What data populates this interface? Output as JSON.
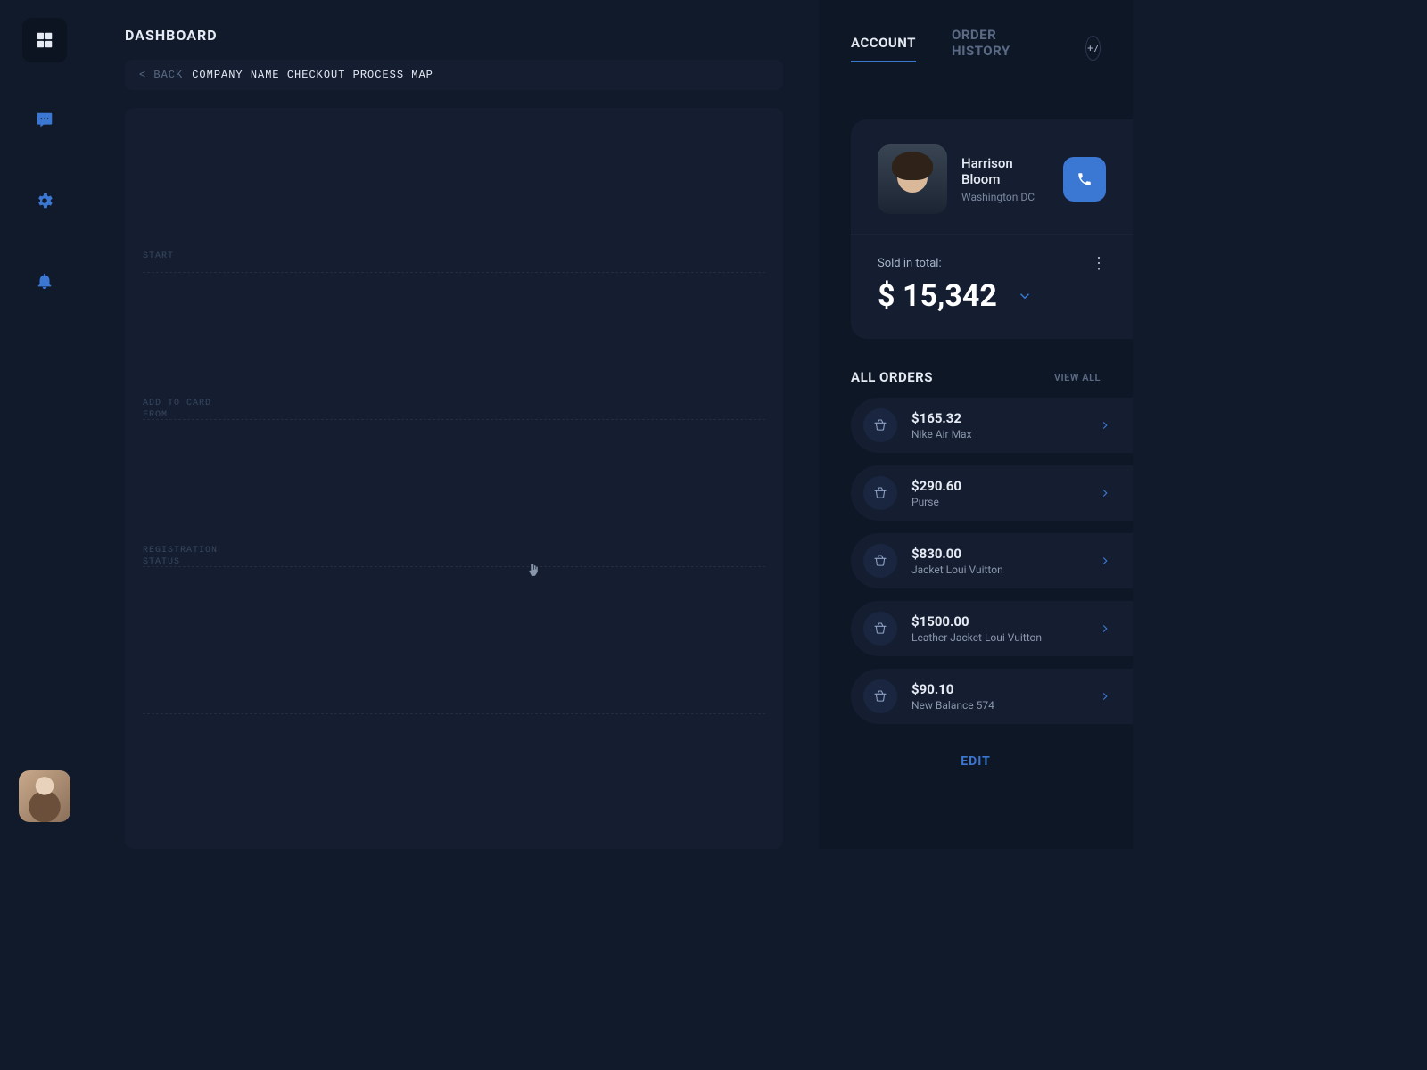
{
  "sidebar": {
    "items": [
      {
        "name": "dashboard-icon"
      },
      {
        "name": "chat-icon"
      },
      {
        "name": "settings-icon"
      },
      {
        "name": "bell-icon"
      }
    ]
  },
  "header": {
    "title": "DASHBOARD",
    "back_label": "< BACK",
    "breadcrumb": "COMPANY NAME CHECKOUT PROCESS MAP"
  },
  "canvas": {
    "lanes": [
      {
        "label": "START"
      },
      {
        "label": "ADD TO CARD\nFROM"
      },
      {
        "label": "REGISTRATION\nSTATUS"
      },
      {
        "label": ""
      }
    ]
  },
  "panel": {
    "tabs": {
      "account": "ACCOUNT",
      "history": "ORDER HISTORY",
      "more_count": "+7"
    },
    "profile": {
      "name": "Harrison Bloom",
      "location": "Washington DC"
    },
    "total": {
      "label": "Sold in total:",
      "amount": "$ 15,342"
    },
    "orders": {
      "title": "ALL ORDERS",
      "view_all": "VIEW ALL",
      "items": [
        {
          "price": "$165.32",
          "name": "Nike Air Max"
        },
        {
          "price": "$290.60",
          "name": "Purse"
        },
        {
          "price": "$830.00",
          "name": "Jacket Loui Vuitton"
        },
        {
          "price": "$1500.00",
          "name": "Leather Jacket Loui Vuitton"
        },
        {
          "price": "$90.10",
          "name": "New Balance 574"
        }
      ]
    },
    "edit": "EDIT"
  }
}
